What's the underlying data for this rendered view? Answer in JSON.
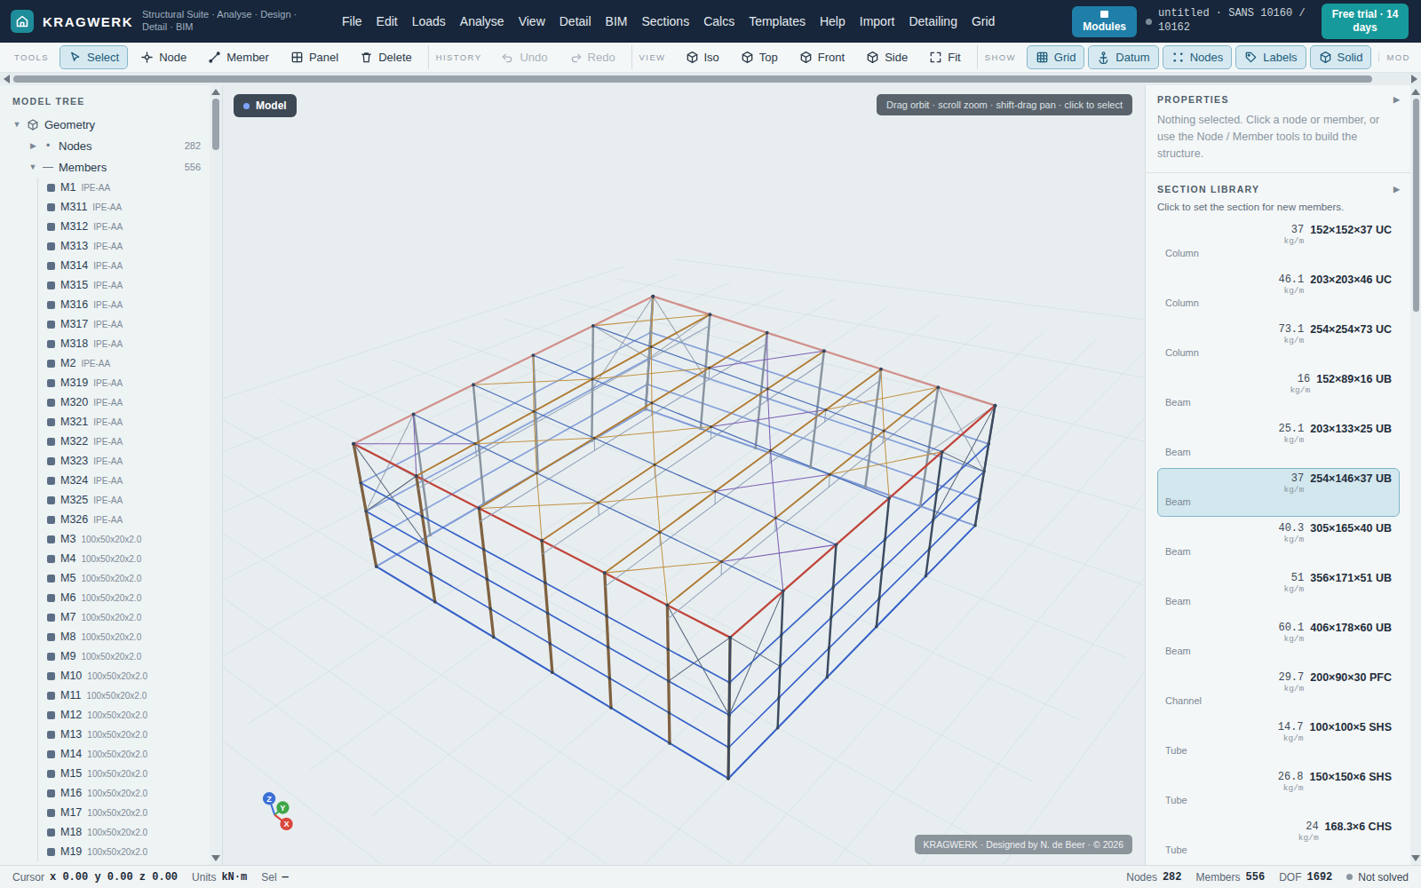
{
  "app": {
    "name": "KRAGWERK",
    "tagline": "Structural Suite · Analyse · Design · Detail · BIM"
  },
  "menu": [
    "File",
    "Edit",
    "Loads",
    "Analyse",
    "View",
    "Detail",
    "BIM",
    "Sections",
    "Calcs",
    "Templates",
    "Help",
    "Import",
    "Detailing",
    "Grid"
  ],
  "modules": {
    "label": "Modules"
  },
  "document": {
    "title": "untitled · SANS 10160 / 10162"
  },
  "trial": {
    "label": "Free trial · 14 days"
  },
  "toolbar": {
    "groups": [
      {
        "label": "TOOLS",
        "buttons": [
          {
            "label": "Select",
            "selected": true,
            "disabled": false
          },
          {
            "label": "Node",
            "selected": false,
            "disabled": false
          },
          {
            "label": "Member",
            "selected": false,
            "disabled": false
          },
          {
            "label": "Panel",
            "selected": false,
            "disabled": false
          },
          {
            "label": "Delete",
            "selected": false,
            "disabled": false
          }
        ]
      },
      {
        "label": "HISTORY",
        "buttons": [
          {
            "label": "Undo",
            "selected": false,
            "disabled": true
          },
          {
            "label": "Redo",
            "selected": false,
            "disabled": true
          }
        ]
      },
      {
        "label": "VIEW",
        "buttons": [
          {
            "label": "Iso",
            "selected": false,
            "disabled": false
          },
          {
            "label": "Top",
            "selected": false,
            "disabled": false
          },
          {
            "label": "Front",
            "selected": false,
            "disabled": false
          },
          {
            "label": "Side",
            "selected": false,
            "disabled": false
          },
          {
            "label": "Fit",
            "selected": false,
            "disabled": false
          }
        ]
      },
      {
        "label": "SHOW",
        "buttons": [
          {
            "label": "Grid",
            "selected": true,
            "disabled": false
          },
          {
            "label": "Datum",
            "selected": true,
            "disabled": false
          },
          {
            "label": "Nodes",
            "selected": true,
            "disabled": false
          },
          {
            "label": "Labels",
            "selected": true,
            "disabled": false
          },
          {
            "label": "Solid",
            "selected": true,
            "disabled": false
          }
        ]
      }
    ],
    "overflow_label": "MOD"
  },
  "tree": {
    "title": "MODEL TREE",
    "root": {
      "label": "Geometry",
      "toggle": "▼",
      "expanded": true
    },
    "groups": [
      {
        "label": "Nodes",
        "glyph": "•",
        "count": "282",
        "toggle": "▶",
        "expanded": false
      },
      {
        "label": "Members",
        "glyph": "—",
        "count": "556",
        "toggle": "▼",
        "expanded": true
      }
    ],
    "members": [
      {
        "name": "M1",
        "section": "IPE-AA"
      },
      {
        "name": "M311",
        "section": "IPE-AA"
      },
      {
        "name": "M312",
        "section": "IPE-AA"
      },
      {
        "name": "M313",
        "section": "IPE-AA"
      },
      {
        "name": "M314",
        "section": "IPE-AA"
      },
      {
        "name": "M315",
        "section": "IPE-AA"
      },
      {
        "name": "M316",
        "section": "IPE-AA"
      },
      {
        "name": "M317",
        "section": "IPE-AA"
      },
      {
        "name": "M318",
        "section": "IPE-AA"
      },
      {
        "name": "M2",
        "section": "IPE-AA"
      },
      {
        "name": "M319",
        "section": "IPE-AA"
      },
      {
        "name": "M320",
        "section": "IPE-AA"
      },
      {
        "name": "M321",
        "section": "IPE-AA"
      },
      {
        "name": "M322",
        "section": "IPE-AA"
      },
      {
        "name": "M323",
        "section": "IPE-AA"
      },
      {
        "name": "M324",
        "section": "IPE-AA"
      },
      {
        "name": "M325",
        "section": "IPE-AA"
      },
      {
        "name": "M326",
        "section": "IPE-AA"
      },
      {
        "name": "M3",
        "section": "100x50x20x2.0"
      },
      {
        "name": "M4",
        "section": "100x50x20x2.0"
      },
      {
        "name": "M5",
        "section": "100x50x20x2.0"
      },
      {
        "name": "M6",
        "section": "100x50x20x2.0"
      },
      {
        "name": "M7",
        "section": "100x50x20x2.0"
      },
      {
        "name": "M8",
        "section": "100x50x20x2.0"
      },
      {
        "name": "M9",
        "section": "100x50x20x2.0"
      },
      {
        "name": "M10",
        "section": "100x50x20x2.0"
      },
      {
        "name": "M11",
        "section": "100x50x20x2.0"
      },
      {
        "name": "M12",
        "section": "100x50x20x2.0"
      },
      {
        "name": "M13",
        "section": "100x50x20x2.0"
      },
      {
        "name": "M14",
        "section": "100x50x20x2.0"
      },
      {
        "name": "M15",
        "section": "100x50x20x2.0"
      },
      {
        "name": "M16",
        "section": "100x50x20x2.0"
      },
      {
        "name": "M17",
        "section": "100x50x20x2.0"
      },
      {
        "name": "M18",
        "section": "100x50x20x2.0"
      },
      {
        "name": "M19",
        "section": "100x50x20x2.0"
      }
    ]
  },
  "viewport": {
    "badge": "Model",
    "hint": "Drag orbit · scroll zoom · shift-drag pan · click to select",
    "watermark": "KRAGWERK · Designed by N. de Beer · © 2026",
    "axes": [
      {
        "label": "Z",
        "color": "#3b6fd6"
      },
      {
        "label": "Y",
        "color": "#3fa64a"
      },
      {
        "label": "X",
        "color": "#d9463b"
      }
    ]
  },
  "properties": {
    "title": "PROPERTIES",
    "toggle": "▶",
    "empty_text": "Nothing selected. Click a node or member, or use the Node / Member tools to build the structure."
  },
  "library": {
    "title": "SECTION LIBRARY",
    "toggle": "▶",
    "hint": "Click to set the section for new members.",
    "items": [
      {
        "mass": "37",
        "unit": "kg/m",
        "name": "152×152×37 UC",
        "category": "Column",
        "selected": false
      },
      {
        "mass": "46.1",
        "unit": "kg/m",
        "name": "203×203×46 UC",
        "category": "Column",
        "selected": false
      },
      {
        "mass": "73.1",
        "unit": "kg/m",
        "name": "254×254×73 UC",
        "category": "Column",
        "selected": false
      },
      {
        "mass": "16",
        "unit": "kg/m",
        "name": "152×89×16 UB",
        "category": "Beam",
        "selected": false
      },
      {
        "mass": "25.1",
        "unit": "kg/m",
        "name": "203×133×25 UB",
        "category": "Beam",
        "selected": false
      },
      {
        "mass": "37",
        "unit": "kg/m",
        "name": "254×146×37 UB",
        "category": "Beam",
        "selected": true
      },
      {
        "mass": "40.3",
        "unit": "kg/m",
        "name": "305×165×40 UB",
        "category": "Beam",
        "selected": false
      },
      {
        "mass": "51",
        "unit": "kg/m",
        "name": "356×171×51 UB",
        "category": "Beam",
        "selected": false
      },
      {
        "mass": "60.1",
        "unit": "kg/m",
        "name": "406×178×60 UB",
        "category": "Beam",
        "selected": false
      },
      {
        "mass": "29.7",
        "unit": "kg/m",
        "name": "200×90×30 PFC",
        "category": "Channel",
        "selected": false
      },
      {
        "mass": "14.7",
        "unit": "kg/m",
        "name": "100×100×5 SHS",
        "category": "Tube",
        "selected": false
      },
      {
        "mass": "26.8",
        "unit": "kg/m",
        "name": "150×150×6 SHS",
        "category": "Tube",
        "selected": false
      },
      {
        "mass": "24",
        "unit": "kg/m",
        "name": "168.3×6 CHS",
        "category": "Tube",
        "selected": false
      }
    ]
  },
  "status": {
    "left": [
      {
        "label": "Cursor",
        "value": "x 0.00 y 0.00 z 0.00"
      },
      {
        "label": "Units",
        "value": "kN·m"
      },
      {
        "label": "Sel",
        "value": "—"
      }
    ],
    "right": [
      {
        "label": "Nodes",
        "value": "282"
      },
      {
        "label": "Members",
        "value": "556"
      },
      {
        "label": "DOF",
        "value": "1692"
      }
    ],
    "solve": {
      "label": "Not solved",
      "solved": false
    }
  }
}
